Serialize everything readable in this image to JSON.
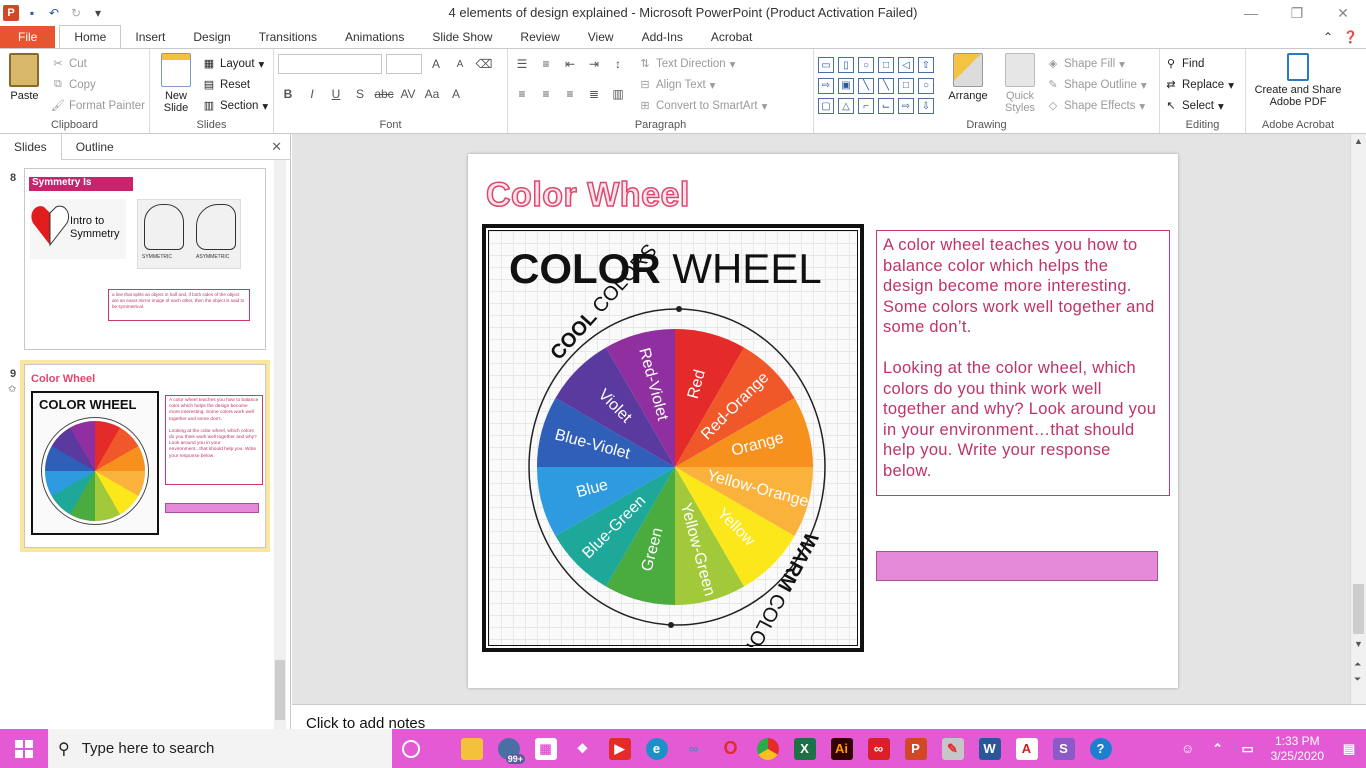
{
  "window": {
    "title": "4 elements of design explained  -  Microsoft PowerPoint (Product Activation Failed)"
  },
  "tabs": [
    "File",
    "Home",
    "Insert",
    "Design",
    "Transitions",
    "Animations",
    "Slide Show",
    "Review",
    "View",
    "Add-Ins",
    "Acrobat"
  ],
  "ribbon": {
    "clipboard": {
      "label": "Clipboard",
      "paste": "Paste",
      "cut": "Cut",
      "copy": "Copy",
      "format_painter": "Format Painter"
    },
    "slides": {
      "label": "Slides",
      "new_slide": "New Slide",
      "layout": "Layout",
      "reset": "Reset",
      "section": "Section"
    },
    "font": {
      "label": "Font"
    },
    "paragraph": {
      "label": "Paragraph",
      "text_direction": "Text Direction",
      "align_text": "Align Text",
      "convert_smartart": "Convert to SmartArt"
    },
    "drawing": {
      "label": "Drawing",
      "arrange": "Arrange",
      "quick_styles": "Quick Styles",
      "shape_fill": "Shape Fill",
      "shape_outline": "Shape Outline",
      "shape_effects": "Shape Effects"
    },
    "editing": {
      "label": "Editing",
      "find": "Find",
      "replace": "Replace",
      "select": "Select"
    },
    "acrobat": {
      "label": "Adobe Acrobat",
      "create_share": "Create and Share Adobe PDF"
    }
  },
  "pane": {
    "tabs": [
      "Slides",
      "Outline"
    ]
  },
  "thumbs": [
    {
      "num": "8",
      "title": "Symmetry Is",
      "intro": "Intro to Symmetry",
      "sym": "SYMMETRIC",
      "asym": "ASYMMETRIC",
      "text": "a line that splits an object in half and, if both sides of the object are an exact mirror image of each other, then the object is said to be symmetrical."
    },
    {
      "num": "9",
      "title": "Color Wheel",
      "cw": "COLOR WHEEL",
      "text1": "A color wheel teaches you how to balance color which helps the design become more interesting. Some colors work well together and some don't.",
      "text2": "Looking at the color wheel, which colors do you think work well together and why? Look around you in your environment...that should help you. Write your response below."
    }
  ],
  "slide": {
    "title": "Color Wheel",
    "image": {
      "heading_bold": "COLOR",
      "heading_light": "WHEEL",
      "cool_bold": "COOL",
      "cool_light": "COLORS",
      "warm_bold": "WARM",
      "warm_light": "COLORS",
      "segments": [
        {
          "label": "Red",
          "color": "#e52a2a"
        },
        {
          "label": "Red-Orange",
          "color": "#f0582a"
        },
        {
          "label": "Orange",
          "color": "#f7911e"
        },
        {
          "label": "Yellow-Orange",
          "color": "#fbb23c"
        },
        {
          "label": "Yellow",
          "color": "#fbe71a"
        },
        {
          "label": "Yellow-Green",
          "color": "#a2c93a"
        },
        {
          "label": "Green",
          "color": "#4aab3e"
        },
        {
          "label": "Blue-Green",
          "color": "#1ea89a"
        },
        {
          "label": "Blue",
          "color": "#2e9be0"
        },
        {
          "label": "Blue-Violet",
          "color": "#2f5fb8"
        },
        {
          "label": "Violet",
          "color": "#5a3a9e"
        },
        {
          "label": "Red-Violet",
          "color": "#8f2fa0"
        }
      ]
    },
    "text_p1": "A color wheel teaches you how to balance color which helps the design become more interesting. Some colors work well together and some don’t.",
    "text_p2": "Looking at the color wheel, which colors do you think work well together and why?  Look around you in your environment…that should help you.  Write your response below."
  },
  "notes": {
    "placeholder": "Click to add notes"
  },
  "taskbar": {
    "search": "Type here to search",
    "badge": "99+",
    "time": "1:33 PM",
    "date": "3/25/2020"
  }
}
